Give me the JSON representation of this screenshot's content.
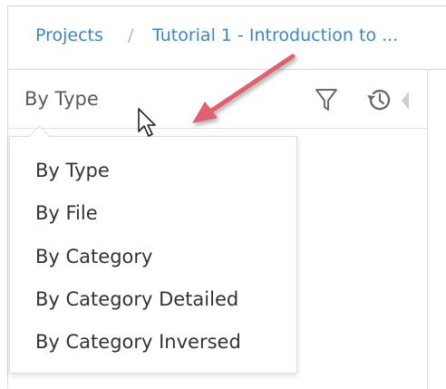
{
  "breadcrumb": {
    "projects": "Projects",
    "separator": "/",
    "current": "Tutorial 1 - Introduction to ..."
  },
  "panel": {
    "view_selector_value": "By Type",
    "filter_icon": "filter-icon",
    "history_icon": "history-icon",
    "collapse_icon": "collapse-left-icon"
  },
  "dropdown": {
    "items": [
      "By Type",
      "By File",
      "By Category",
      "By Category Detailed",
      "By Category Inversed"
    ]
  },
  "colors": {
    "link": "#3a86c8",
    "annotation_arrow": "#e06070"
  }
}
